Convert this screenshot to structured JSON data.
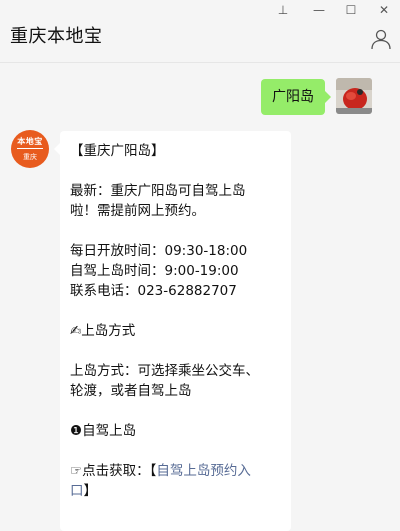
{
  "header": {
    "title": "重庆本地宝"
  },
  "window_controls": {
    "pin": "⊥",
    "minimize": "—",
    "maximize": "☐",
    "close": "✕"
  },
  "chat": {
    "outgoing": {
      "text": "广阳岛"
    },
    "incoming": {
      "avatar_text_top": "本地宝",
      "avatar_text_bottom": "重庆",
      "lines": {
        "title": "【重庆广阳岛】",
        "news_1": "最新：重庆广阳岛可自驾上岛",
        "news_2": "啦！需提前网上预约。",
        "open_time": "每日开放时间：09:30-18:00",
        "drive_time": "自驾上岛时间：9:00-19:00",
        "phone": "联系电话：023-62882707",
        "method_heading": "✍上岛方式",
        "method_1": "上岛方式：可选择乘坐公交车、",
        "method_2": "轮渡，或者自驾上岛",
        "drive_heading": "❶自驾上岛",
        "click_prefix": "☞点击获取：【",
        "click_link_1": "自驾上岛预约入",
        "click_link_2": "口",
        "click_suffix": "】"
      }
    }
  },
  "colors": {
    "background": "#f5f5f5",
    "outgoing_bubble": "#95ec69",
    "incoming_bubble": "#ffffff",
    "link": "#576b95",
    "bot_avatar": "#e85b1e"
  },
  "icons": {
    "profile": "person-outline-icon"
  }
}
